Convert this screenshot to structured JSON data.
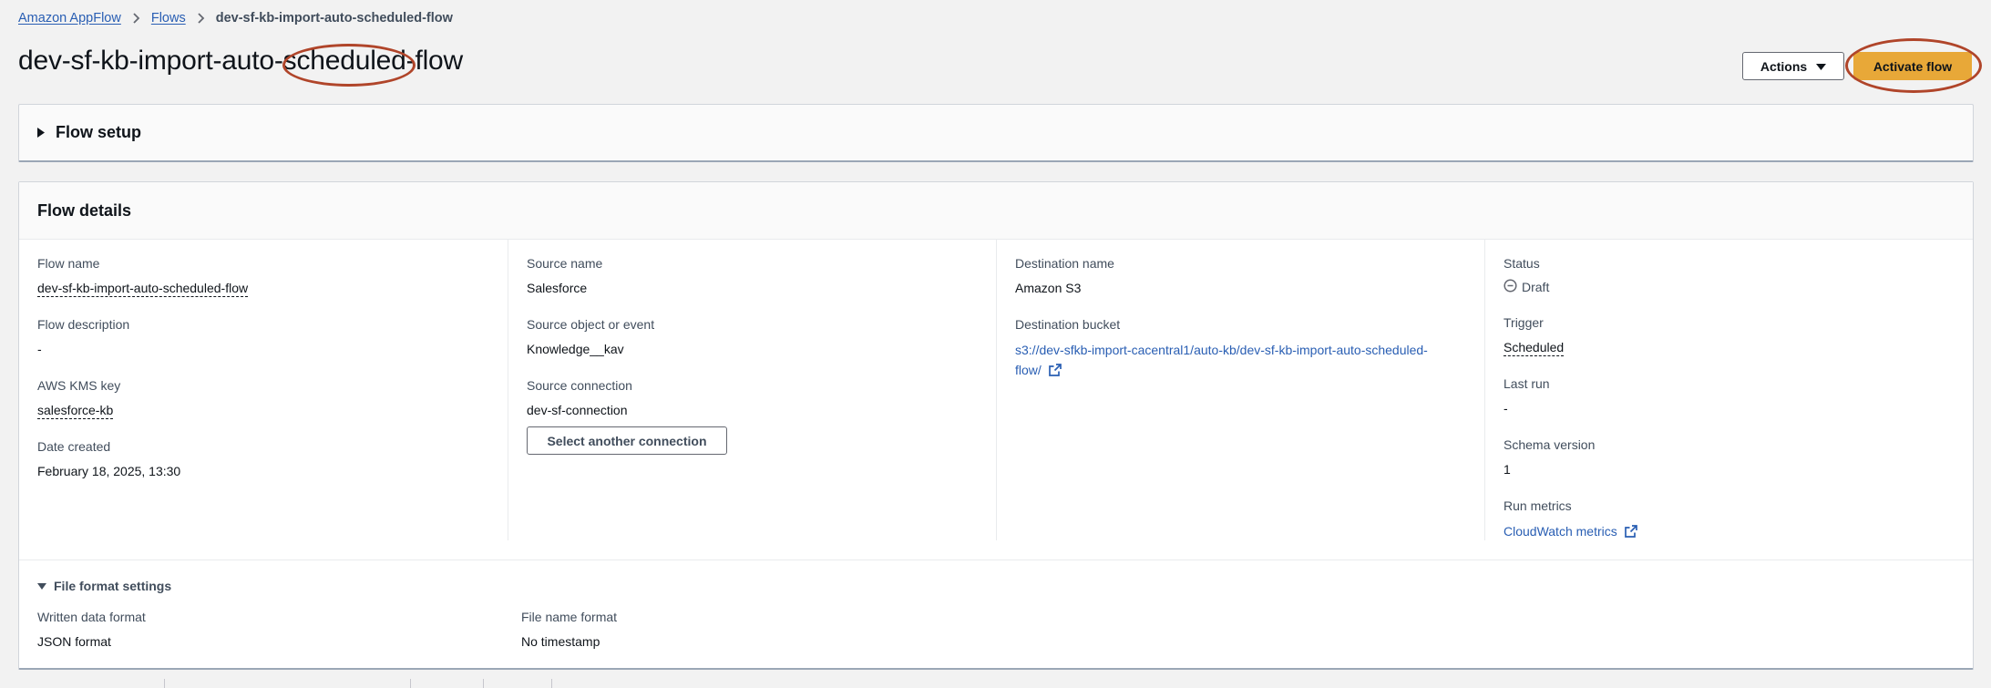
{
  "breadcrumb": {
    "items": [
      "Amazon AppFlow",
      "Flows"
    ],
    "current": "dev-sf-kb-import-auto-scheduled-flow"
  },
  "header": {
    "title": "dev-sf-kb-import-auto-scheduled-flow",
    "actions_label": "Actions",
    "activate_label": "Activate flow"
  },
  "flow_setup": {
    "label": "Flow setup"
  },
  "flow_details": {
    "title": "Flow details",
    "flow_name_label": "Flow name",
    "flow_name": "dev-sf-kb-import-auto-scheduled-flow",
    "flow_description_label": "Flow description",
    "flow_description": "-",
    "kms_key_label": "AWS KMS key",
    "kms_key": "salesforce-kb",
    "date_created_label": "Date created",
    "date_created": "February 18, 2025, 13:30",
    "source_name_label": "Source name",
    "source_name": "Salesforce",
    "source_object_label": "Source object or event",
    "source_object": "Knowledge__kav",
    "source_connection_label": "Source connection",
    "source_connection": "dev-sf-connection",
    "select_connection_label": "Select another connection",
    "destination_name_label": "Destination name",
    "destination_name": "Amazon S3",
    "destination_bucket_label": "Destination bucket",
    "destination_bucket_line1": "s3://dev-sfkb-import-cacentral1/auto-kb/dev-sf-kb-import-auto-scheduled-",
    "destination_bucket_line2": "flow/",
    "status_label": "Status",
    "status": "Draft",
    "trigger_label": "Trigger",
    "trigger": "Scheduled",
    "last_run_label": "Last run",
    "last_run": "-",
    "schema_version_label": "Schema version",
    "schema_version": "1",
    "run_metrics_label": "Run metrics",
    "run_metrics_link": "CloudWatch metrics"
  },
  "file_format": {
    "title": "File format settings",
    "written_format_label": "Written data format",
    "written_format": "JSON format",
    "file_name_format_label": "File name format",
    "file_name_format": "No timestamp"
  },
  "colors": {
    "accent": "#e8a838",
    "link": "#295eb3",
    "annotation": "#b0452a"
  }
}
